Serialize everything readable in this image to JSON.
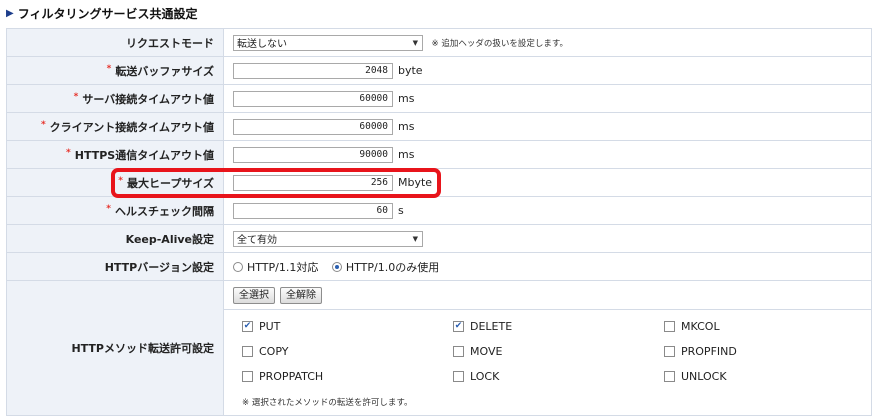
{
  "section": {
    "title": "フィルタリングサービス共通設定",
    "marker": "▶"
  },
  "request_mode": {
    "label": "リクエストモード",
    "selected": "転送しない",
    "note": "※ 追加ヘッダの扱いを設定します。"
  },
  "required_mark": "*",
  "buffer_size": {
    "label": "転送バッファサイズ",
    "value": "2048",
    "unit": "byte"
  },
  "server_timeout": {
    "label": "サーバ接続タイムアウト値",
    "value": "60000",
    "unit": "ms"
  },
  "client_timeout": {
    "label": "クライアント接続タイムアウト値",
    "value": "60000",
    "unit": "ms"
  },
  "https_timeout": {
    "label": "HTTPS通信タイムアウト値",
    "value": "90000",
    "unit": "ms"
  },
  "max_heap": {
    "label": "最大ヒープサイズ",
    "value": "256",
    "unit": "Mbyte"
  },
  "health_check": {
    "label": "ヘルスチェック間隔",
    "value": "60",
    "unit": "s"
  },
  "keep_alive": {
    "label": "Keep-Alive設定",
    "selected": "全て有効"
  },
  "http_version": {
    "label": "HTTPバージョン設定",
    "options": [
      {
        "label": "HTTP/1.1対応",
        "checked": false
      },
      {
        "label": "HTTP/1.0のみ使用",
        "checked": true
      }
    ]
  },
  "methods": {
    "label": "HTTPメソッド転送許可設定",
    "select_all": "全選択",
    "clear_all": "全解除",
    "items": [
      {
        "label": "PUT",
        "checked": true
      },
      {
        "label": "DELETE",
        "checked": true
      },
      {
        "label": "MKCOL",
        "checked": false
      },
      {
        "label": "COPY",
        "checked": false
      },
      {
        "label": "MOVE",
        "checked": false
      },
      {
        "label": "PROPFIND",
        "checked": false
      },
      {
        "label": "PROPPATCH",
        "checked": false
      },
      {
        "label": "LOCK",
        "checked": false
      },
      {
        "label": "UNLOCK",
        "checked": false
      }
    ],
    "note": "※ 選択されたメソッドの転送を許可します。"
  },
  "colors": {
    "highlight": "#e8141b",
    "label_bg": "#eef2f8",
    "required": "#e6322b",
    "accent": "#1d3e8c"
  }
}
